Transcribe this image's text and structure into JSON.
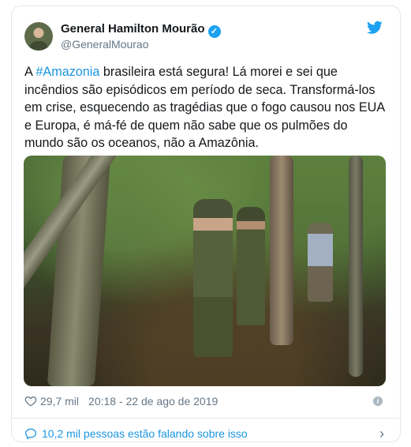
{
  "tweet": {
    "author_name": "General Hamilton Mourão",
    "handle": "@GeneralMourao",
    "text_before_tag": "A ",
    "hashtag": "#Amazonia",
    "text_after_tag": " brasileira está segura! Lá morei e sei que incêndios são episódicos em período de seca. Transformá-los em crise, esquecendo as tragédias que o fogo causou nos EUA e Europa, é má-fé de quem não sabe que os pulmões do mundo são os oceanos, não a Amazônia.",
    "likes": "29,7 mil",
    "timestamp": "20:18 - 22 de ago de 2019",
    "conversation_link": "10,2 mil pessoas estão falando sobre isso"
  },
  "icons": {
    "verified": "verified-badge-icon",
    "platform": "bird-icon",
    "like": "heart-icon",
    "info": "info-icon",
    "reply": "speech-bubble-icon",
    "more": "chevron-right-icon"
  },
  "colors": {
    "accent": "#1da1f2",
    "link": "#1b95e0",
    "text": "#14171a",
    "muted": "#657786"
  }
}
